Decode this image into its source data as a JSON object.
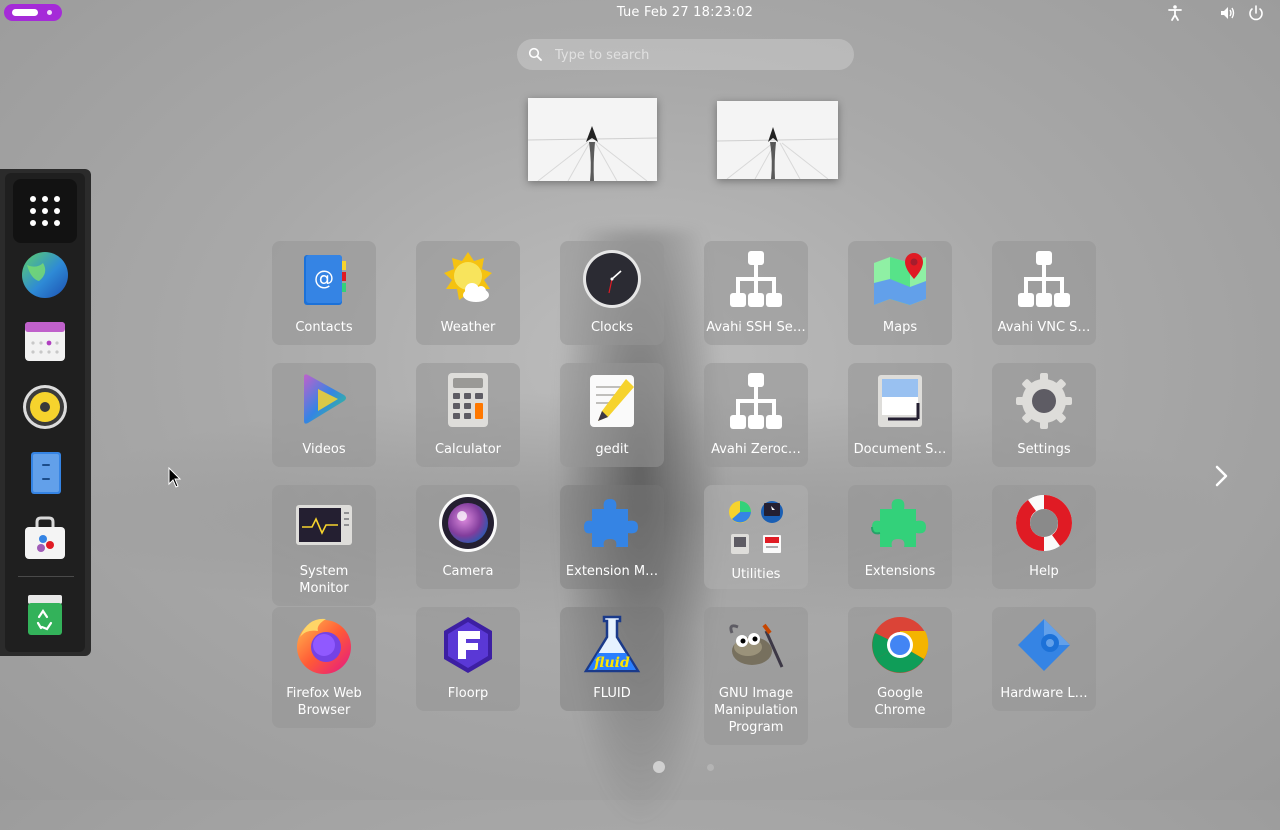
{
  "topbar": {
    "datetime": "Tue Feb 27  18:23:02",
    "icons": [
      "accessibility-icon",
      "volume-icon",
      "power-icon"
    ]
  },
  "search": {
    "placeholder": "Type to search"
  },
  "dash": {
    "items": [
      {
        "name": "show-apps",
        "icon": "app-grid-icon"
      },
      {
        "name": "web-browser",
        "icon": "globe-icon"
      },
      {
        "name": "calendar",
        "icon": "calendar-icon"
      },
      {
        "name": "rhythmbox",
        "icon": "speaker-icon"
      },
      {
        "name": "files",
        "icon": "files-icon"
      },
      {
        "name": "software",
        "icon": "software-bag-icon"
      },
      {
        "name": "trash",
        "icon": "trash-icon"
      }
    ]
  },
  "apps": [
    {
      "label": "Contacts",
      "icon": "contacts-icon"
    },
    {
      "label": "Weather",
      "icon": "weather-icon"
    },
    {
      "label": "Clocks",
      "icon": "clock-icon"
    },
    {
      "label": "Avahi SSH Se…",
      "icon": "network-icon"
    },
    {
      "label": "Maps",
      "icon": "maps-icon"
    },
    {
      "label": "Avahi VNC S…",
      "icon": "network-icon"
    },
    {
      "label": "Videos",
      "icon": "videos-icon"
    },
    {
      "label": "Calculator",
      "icon": "calculator-icon"
    },
    {
      "label": "gedit",
      "icon": "text-editor-icon"
    },
    {
      "label": "Avahi Zeroc…",
      "icon": "network-icon"
    },
    {
      "label": "Document S…",
      "icon": "document-scanner-icon"
    },
    {
      "label": "Settings",
      "icon": "gear-icon"
    },
    {
      "label": "System\nMonitor",
      "icon": "system-monitor-icon"
    },
    {
      "label": "Camera",
      "icon": "camera-icon"
    },
    {
      "label": "Extension M…",
      "icon": "puzzle-blue-icon"
    },
    {
      "label": "Utilities",
      "icon": "folder-icon"
    },
    {
      "label": "Extensions",
      "icon": "puzzle-green-icon"
    },
    {
      "label": "Help",
      "icon": "lifebuoy-icon"
    },
    {
      "label": "Firefox Web\nBrowser",
      "icon": "firefox-icon"
    },
    {
      "label": "Floorp",
      "icon": "floorp-icon"
    },
    {
      "label": "FLUID",
      "icon": "fluid-flask-icon"
    },
    {
      "label": "GNU Image\nManipulation\nProgram",
      "icon": "gimp-icon"
    },
    {
      "label": "Google\nChrome",
      "icon": "chrome-icon"
    },
    {
      "label": "Hardware L…",
      "icon": "hardware-icon"
    }
  ],
  "fluid_icon_text": "fluid",
  "pagination": {
    "pages": 2,
    "current": 1
  },
  "colors": {
    "activities": "#a52bd8",
    "dash": "#1f1f1f"
  }
}
